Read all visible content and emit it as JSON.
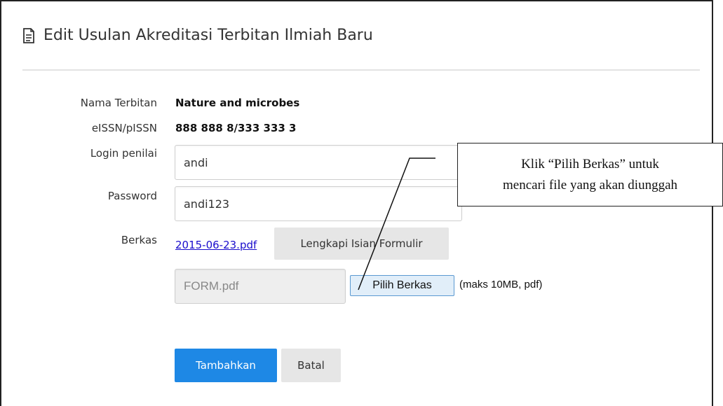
{
  "header": {
    "icon": "document-icon",
    "title": "Edit Usulan Akreditasi Terbitan Ilmiah Baru"
  },
  "form": {
    "nama_terbitan": {
      "label": "Nama Terbitan",
      "value": "Nature and microbes"
    },
    "issn": {
      "label": "eISSN/pISSN",
      "value": "888 888 8/333 333 3"
    },
    "login_penilai": {
      "label": "Login penilai",
      "value": "andi"
    },
    "password": {
      "label": "Password",
      "value": "andi123"
    },
    "berkas": {
      "label": "Berkas",
      "file_link": "2015-06-23.pdf",
      "complete_button": "Lengkapi Isian Formulir",
      "file_field_value": "FORM.pdf",
      "choose_button": "Pilih Berkas",
      "hint": "(maks 10MB, pdf)"
    }
  },
  "actions": {
    "submit": "Tambahkan",
    "cancel": "Batal"
  },
  "callout": {
    "line1": "Klik “Pilih Berkas” untuk",
    "line2": "mencari file yang akan diunggah"
  },
  "colors": {
    "primary": "#1e88e5",
    "link": "#1a0dcc"
  }
}
